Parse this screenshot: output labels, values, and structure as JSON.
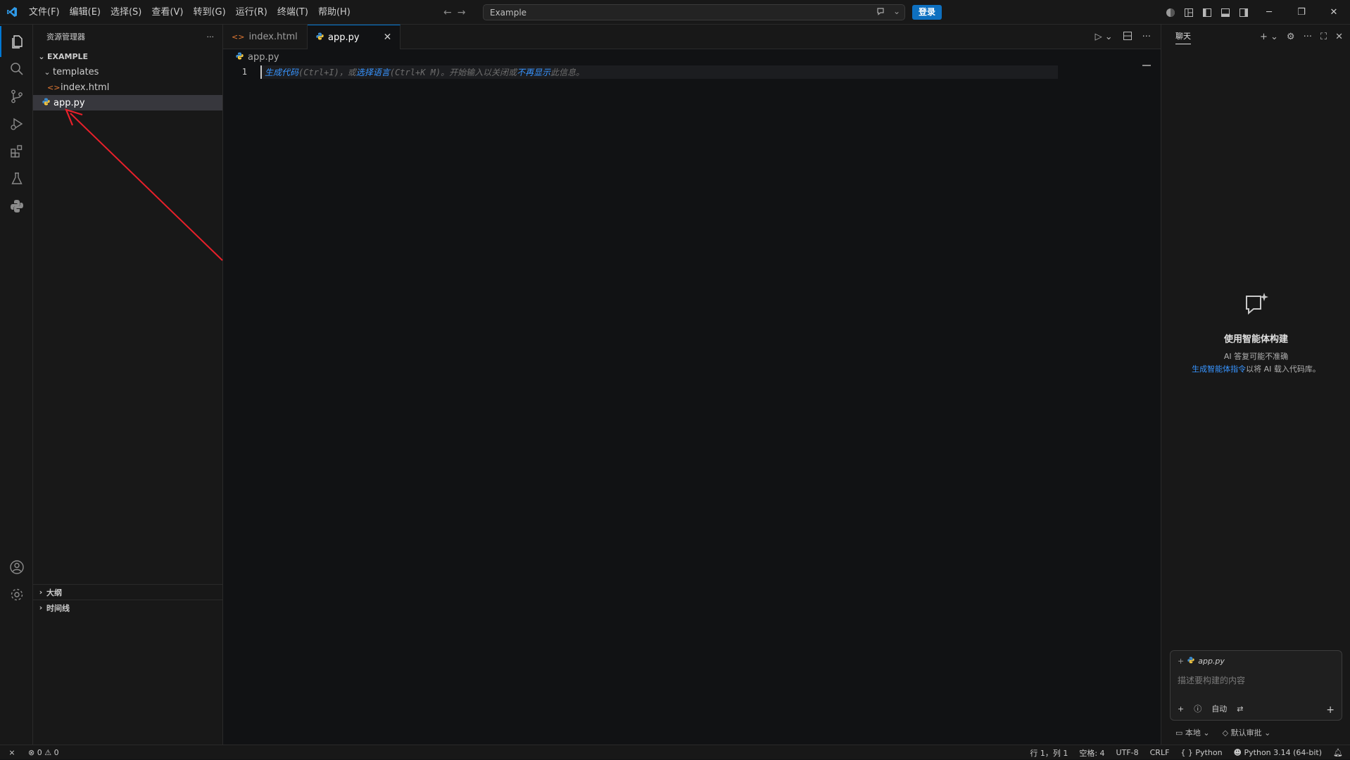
{
  "colors": {
    "accent": "#0078d4",
    "link": "#3794ff",
    "login_bg": "#0e70c0",
    "annotation": "#e8202a",
    "python_file": "#3c8fd4",
    "html_file": "#e37933"
  },
  "menu": [
    "文件(F)",
    "编辑(E)",
    "选择(S)",
    "查看(V)",
    "转到(G)",
    "运行(R)",
    "终端(T)",
    "帮助(H)"
  ],
  "search": {
    "value": "Example"
  },
  "login_label": "登录",
  "explorer": {
    "title": "资源管理器",
    "more": "···",
    "root": "EXAMPLE",
    "folder": "templates",
    "folder_file": "index.html",
    "root_file": "app.py",
    "outline": "大纲",
    "timeline": "时间线"
  },
  "tabs": [
    {
      "label": "index.html",
      "icon": "html-file-icon"
    },
    {
      "label": "app.py",
      "icon": "python-file-icon",
      "close": "✕"
    }
  ],
  "breadcrumb": {
    "file": "app.py"
  },
  "editor": {
    "line_number": "1",
    "hint_link1": "生成代码",
    "hint_text1": "(Ctrl+I)，或",
    "hint_link2": "选择语言",
    "hint_text2": "(Ctrl+K M)。开始输入以关闭或",
    "hint_link3": "不再显示",
    "hint_text3": "此信息。"
  },
  "chat": {
    "title": "聊天",
    "empty_title": "使用智能体构建",
    "empty_note": "AI 答复可能不准确",
    "empty_link": "生成智能体指令",
    "empty_link_suffix": "以将 AI 载入代码库。",
    "attachment": "app.py",
    "placeholder": "描述要构建的内容",
    "mode": "自动",
    "location": "本地",
    "approval": "默认审批"
  },
  "status": {
    "errors": "0",
    "warnings": "0",
    "position": "行 1，列 1",
    "spaces": "空格: 4",
    "encoding": "UTF-8",
    "eol": "CRLF",
    "language": "Python",
    "interpreter": "Python 3.14 (64-bit)"
  }
}
